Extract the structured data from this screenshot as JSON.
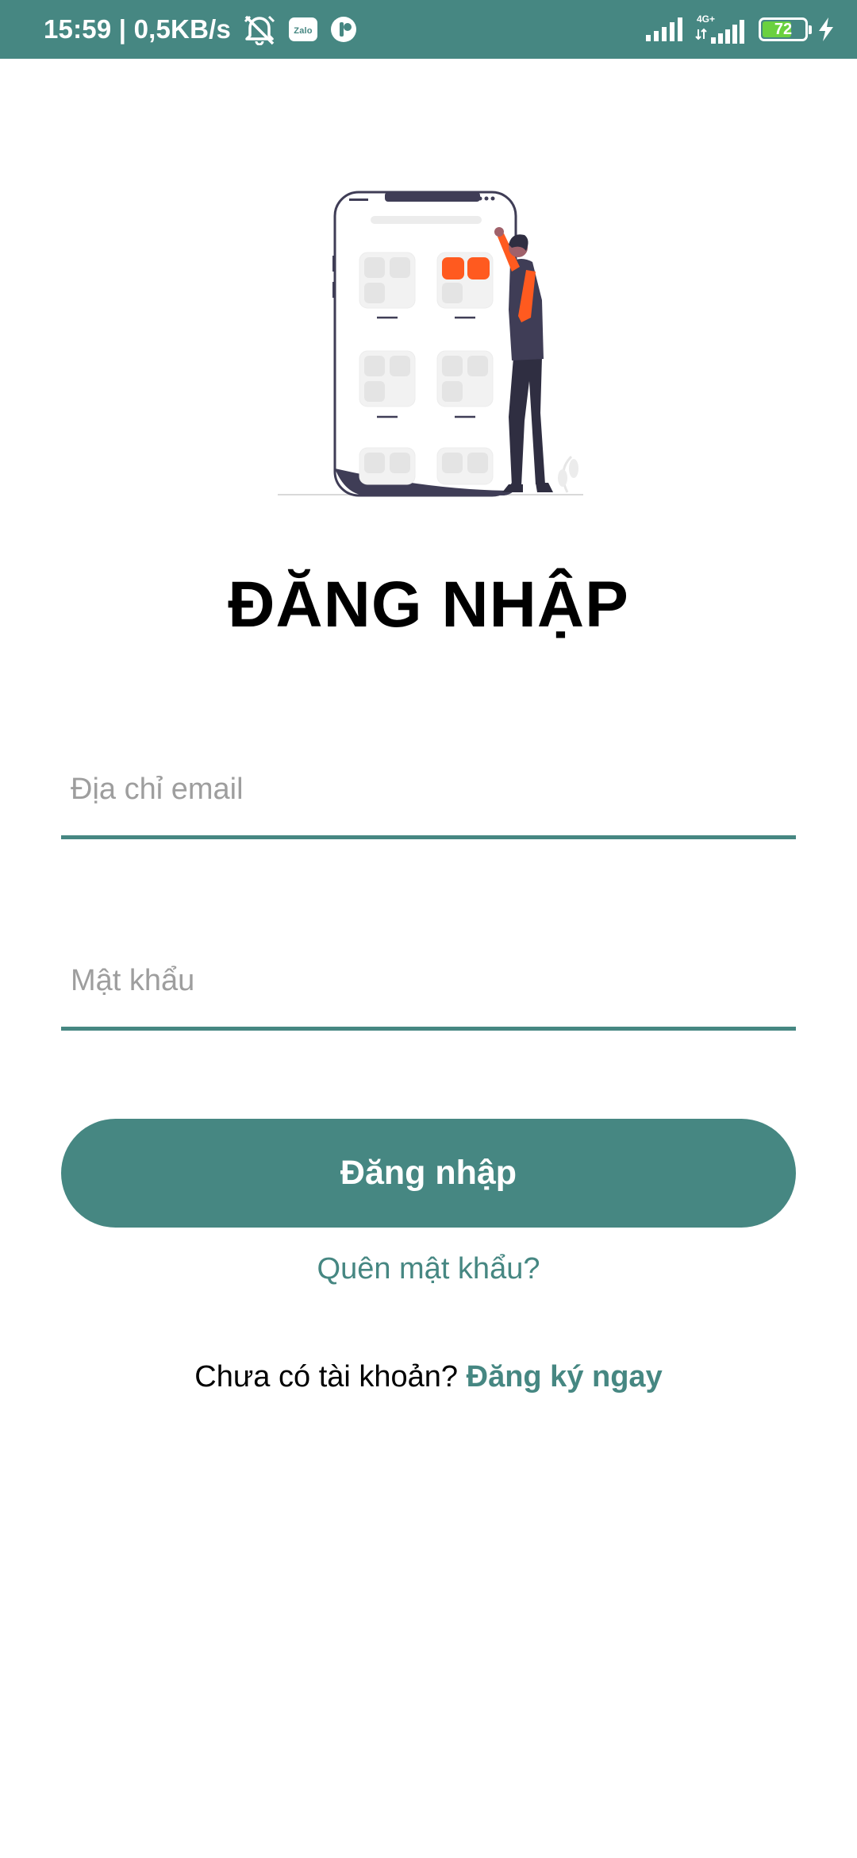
{
  "status_bar": {
    "time_speed": "15:59 | 0,5KB/s",
    "zalo_label": "Zalo",
    "network_label": "4G+",
    "battery_level": "72",
    "battery_fraction": 0.72,
    "icons": [
      "alarm-off-icon",
      "zalo-icon",
      "app-icon",
      "signal-icon",
      "signal-4g-icon",
      "battery-icon",
      "charging-icon"
    ]
  },
  "login": {
    "title": "ĐĂNG NHẬP",
    "email_placeholder": "Địa chỉ email",
    "email_value": "",
    "password_placeholder": "Mật khẩu",
    "password_value": "",
    "login_button_label": "Đăng nhập",
    "forgot_password_label": "Quên mật khẩu?",
    "no_account_text": "Chưa có tài khoản?",
    "signup_link_label": "Đăng ký ngay"
  },
  "colors": {
    "primary": "#468782",
    "accent_orange": "#ff5a1f",
    "text": "#000000",
    "placeholder": "#9e9e9e"
  }
}
